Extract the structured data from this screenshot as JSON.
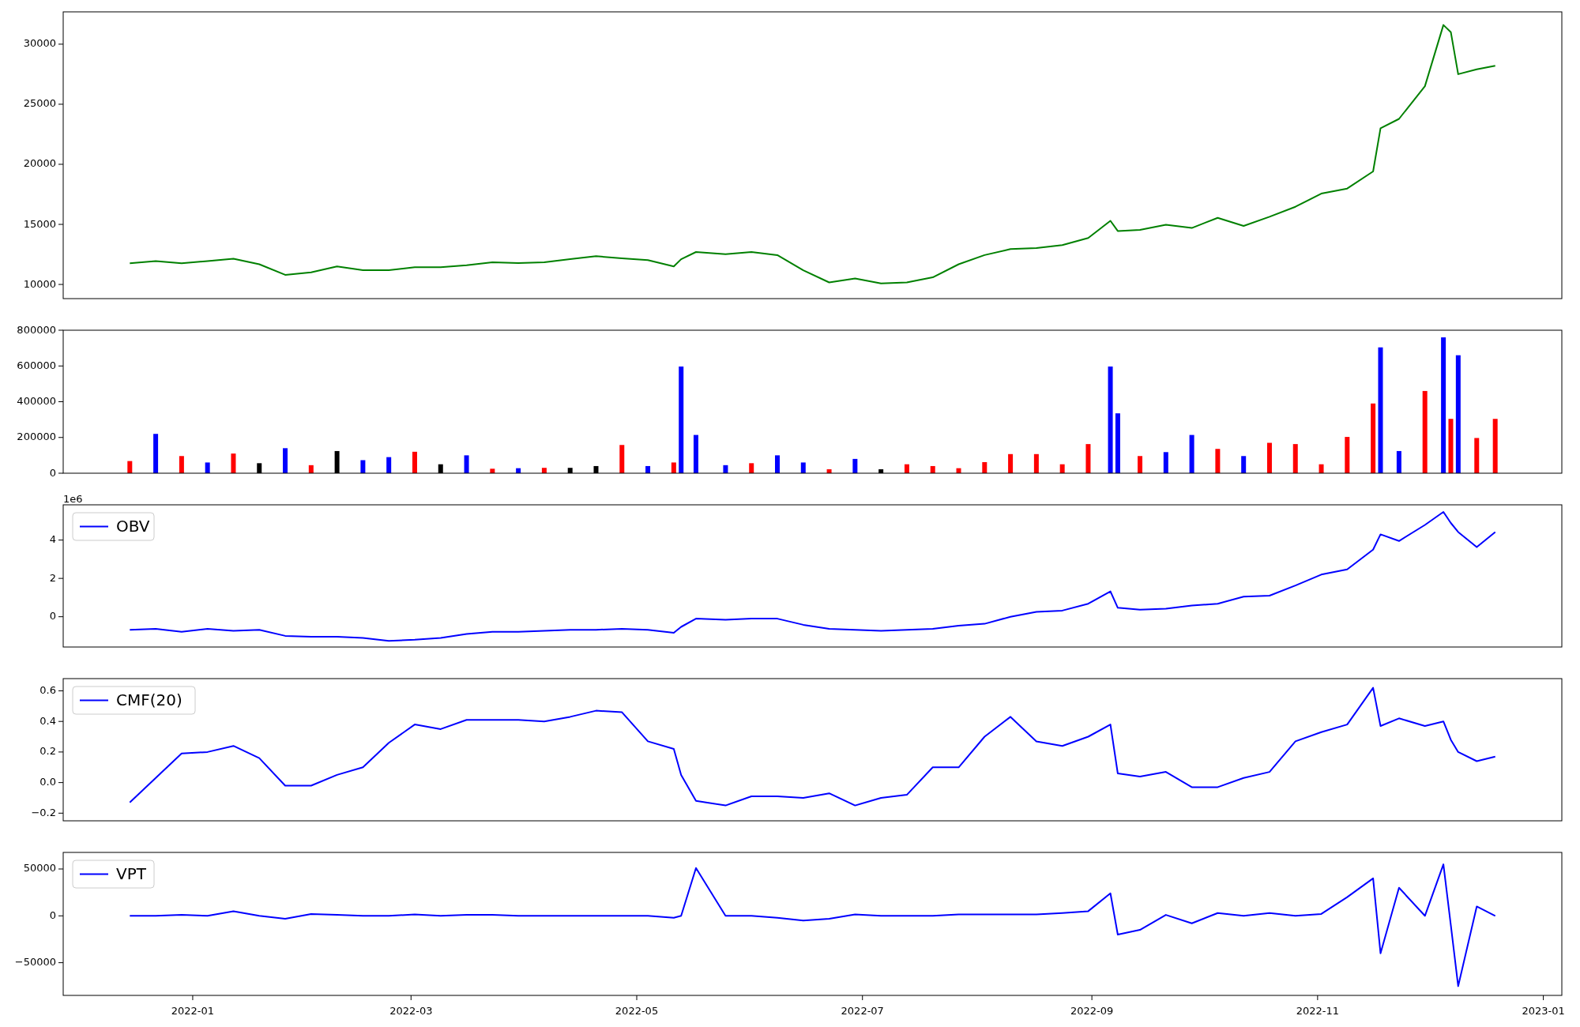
{
  "panels": [
    {
      "chart_data": {
        "type": "line",
        "x": [
          "2021-12-15",
          "2021-12-22",
          "2021-12-29",
          "2022-01-05",
          "2022-01-12",
          "2022-01-19",
          "2022-01-26",
          "2022-02-02",
          "2022-02-09",
          "2022-02-16",
          "2022-02-23",
          "2022-03-02",
          "2022-03-09",
          "2022-03-16",
          "2022-03-23",
          "2022-03-30",
          "2022-04-06",
          "2022-04-13",
          "2022-04-20",
          "2022-04-27",
          "2022-05-04",
          "2022-05-11",
          "2022-05-13",
          "2022-05-17",
          "2022-05-25",
          "2022-06-01",
          "2022-06-08",
          "2022-06-15",
          "2022-06-22",
          "2022-06-29",
          "2022-07-06",
          "2022-07-13",
          "2022-07-20",
          "2022-07-27",
          "2022-08-03",
          "2022-08-10",
          "2022-08-17",
          "2022-08-24",
          "2022-08-31",
          "2022-09-06",
          "2022-09-08",
          "2022-09-14",
          "2022-09-21",
          "2022-09-28",
          "2022-10-05",
          "2022-10-12",
          "2022-10-19",
          "2022-10-26",
          "2022-11-02",
          "2022-11-09",
          "2022-11-16",
          "2022-11-18",
          "2022-11-23",
          "2022-11-30",
          "2022-12-05",
          "2022-12-07",
          "2022-12-09",
          "2022-12-14",
          "2022-12-19"
        ],
        "series": [
          {
            "color": "#008000",
            "values": [
              11760,
              11950,
              11760,
              11950,
              12150,
              11680,
              10800,
              11000,
              11500,
              11180,
              11180,
              11430,
              11430,
              11600,
              11850,
              11770,
              11850,
              12100,
              12350,
              12180,
              12020,
              11500,
              12100,
              12700,
              12520,
              12690,
              12440,
              11180,
              10170,
              10500,
              10080,
              10170,
              10590,
              11680,
              12440,
              12940,
              13030,
              13280,
              13870,
              15300,
              14450,
              14540,
              14960,
              14700,
              15550,
              14870,
              15630,
              16470,
              17560,
              17980,
              19410,
              23000,
              23780,
              26500,
              31600,
              31000,
              27500,
              27900,
              28200
            ]
          }
        ],
        "xlim": [
          "2021-11-27",
          "2023-01-06"
        ],
        "ylim": [
          8820,
          32690
        ],
        "yticks": [
          10000,
          15000,
          20000,
          25000,
          30000
        ]
      }
    },
    {
      "chart_data": {
        "type": "bar",
        "x": [
          "2021-12-15",
          "2021-12-22",
          "2021-12-29",
          "2022-01-05",
          "2022-01-12",
          "2022-01-19",
          "2022-01-26",
          "2022-02-02",
          "2022-02-09",
          "2022-02-16",
          "2022-02-23",
          "2022-03-02",
          "2022-03-09",
          "2022-03-16",
          "2022-03-23",
          "2022-03-30",
          "2022-04-06",
          "2022-04-13",
          "2022-04-20",
          "2022-04-27",
          "2022-05-04",
          "2022-05-11",
          "2022-05-13",
          "2022-05-17",
          "2022-05-25",
          "2022-06-01",
          "2022-06-08",
          "2022-06-15",
          "2022-06-22",
          "2022-06-29",
          "2022-07-06",
          "2022-07-13",
          "2022-07-20",
          "2022-07-27",
          "2022-08-03",
          "2022-08-10",
          "2022-08-17",
          "2022-08-24",
          "2022-08-31",
          "2022-09-06",
          "2022-09-08",
          "2022-09-14",
          "2022-09-21",
          "2022-09-28",
          "2022-10-05",
          "2022-10-12",
          "2022-10-19",
          "2022-10-26",
          "2022-11-02",
          "2022-11-09",
          "2022-11-16",
          "2022-11-18",
          "2022-11-23",
          "2022-11-30",
          "2022-12-05",
          "2022-12-07",
          "2022-12-09",
          "2022-12-14",
          "2022-12-19"
        ],
        "series": [
          {
            "color": "#ff0000",
            "values": [
              68000,
              null,
              96000,
              null,
              110000,
              null,
              null,
              45000,
              null,
              null,
              null,
              120000,
              null,
              null,
              25000,
              null,
              30000,
              null,
              null,
              158000,
              null,
              60000,
              null,
              null,
              null,
              56000,
              null,
              null,
              22000,
              null,
              null,
              50000,
              40000,
              28000,
              62000,
              107000,
              107000,
              50000,
              163000,
              null,
              null,
              96000,
              null,
              null,
              136000,
              null,
              170000,
              163000,
              50000,
              203000,
              390000,
              null,
              null,
              460000,
              null,
              304000,
              null,
              197000,
              304000
            ]
          },
          {
            "color": "#0000ff",
            "values": [
              null,
              220000,
              null,
              60000,
              null,
              null,
              140000,
              null,
              null,
              73000,
              90000,
              null,
              null,
              100000,
              null,
              28000,
              null,
              null,
              null,
              null,
              40000,
              null,
              597000,
              214000,
              45000,
              null,
              100000,
              60000,
              null,
              80000,
              null,
              null,
              null,
              null,
              null,
              null,
              null,
              null,
              null,
              597000,
              335000,
              null,
              118000,
              214000,
              null,
              96000,
              null,
              null,
              null,
              null,
              null,
              704000,
              124000,
              null,
              760000,
              null,
              660000,
              null,
              null
            ]
          },
          {
            "color": "#000000",
            "values": [
              null,
              null,
              null,
              null,
              null,
              56000,
              null,
              null,
              124000,
              null,
              null,
              null,
              50000,
              null,
              null,
              null,
              null,
              30000,
              40000,
              null,
              null,
              null,
              null,
              null,
              null,
              null,
              null,
              null,
              null,
              null,
              22000,
              null,
              null,
              null,
              null,
              null,
              null,
              null,
              null,
              null,
              null,
              null,
              null,
              null,
              null,
              null,
              null,
              null,
              null,
              null,
              null,
              null,
              null,
              null,
              null,
              null,
              null,
              null,
              null
            ]
          }
        ],
        "xlim": [
          "2021-11-27",
          "2023-01-06"
        ],
        "ylim": [
          0,
          800000
        ],
        "yticks": [
          0,
          200000,
          400000,
          600000,
          800000
        ]
      }
    },
    {
      "chart_data": {
        "type": "line",
        "x": [
          "2021-12-15",
          "2021-12-22",
          "2021-12-29",
          "2022-01-05",
          "2022-01-12",
          "2022-01-19",
          "2022-01-26",
          "2022-02-02",
          "2022-02-09",
          "2022-02-16",
          "2022-02-23",
          "2022-03-02",
          "2022-03-09",
          "2022-03-16",
          "2022-03-23",
          "2022-03-30",
          "2022-04-06",
          "2022-04-13",
          "2022-04-20",
          "2022-04-27",
          "2022-05-04",
          "2022-05-11",
          "2022-05-13",
          "2022-05-17",
          "2022-05-25",
          "2022-06-01",
          "2022-06-08",
          "2022-06-15",
          "2022-06-22",
          "2022-06-29",
          "2022-07-06",
          "2022-07-13",
          "2022-07-20",
          "2022-07-27",
          "2022-08-03",
          "2022-08-10",
          "2022-08-17",
          "2022-08-24",
          "2022-08-31",
          "2022-09-06",
          "2022-09-08",
          "2022-09-14",
          "2022-09-21",
          "2022-09-28",
          "2022-10-05",
          "2022-10-12",
          "2022-10-19",
          "2022-10-26",
          "2022-11-02",
          "2022-11-09",
          "2022-11-16",
          "2022-11-18",
          "2022-11-23",
          "2022-11-30",
          "2022-12-05",
          "2022-12-07",
          "2022-12-09",
          "2022-12-14",
          "2022-12-19"
        ],
        "series": [
          {
            "name": "OBV",
            "color": "#0000ff",
            "values": [
              -0.68,
              -0.63,
              -0.79,
              -0.63,
              -0.74,
              -0.68,
              -1.0,
              -1.05,
              -1.05,
              -1.1,
              -1.26,
              -1.2,
              -1.1,
              -0.9,
              -0.79,
              -0.79,
              -0.74,
              -0.68,
              -0.68,
              -0.63,
              -0.68,
              -0.84,
              -0.53,
              -0.1,
              -0.16,
              -0.1,
              -0.1,
              -0.42,
              -0.63,
              -0.68,
              -0.74,
              -0.68,
              -0.63,
              -0.47,
              -0.37,
              0.0,
              0.26,
              0.32,
              0.68,
              1.32,
              0.47,
              0.37,
              0.42,
              0.58,
              0.68,
              1.05,
              1.1,
              1.63,
              2.2,
              2.47,
              3.5,
              4.3,
              3.95,
              4.79,
              5.47,
              4.89,
              4.42,
              3.63,
              4.42
            ]
          }
        ],
        "xlim": [
          "2021-11-27",
          "2023-01-06"
        ],
        "ylim": [
          -1.58,
          5.84
        ],
        "yticks": [
          0,
          2,
          4
        ],
        "annotations": [
          {
            "text": "1e6"
          }
        ]
      }
    },
    {
      "chart_data": {
        "type": "line",
        "x": [
          "2021-12-15",
          "2021-12-22",
          "2021-12-29",
          "2022-01-05",
          "2022-01-12",
          "2022-01-19",
          "2022-01-26",
          "2022-02-02",
          "2022-02-09",
          "2022-02-16",
          "2022-02-23",
          "2022-03-02",
          "2022-03-09",
          "2022-03-16",
          "2022-03-23",
          "2022-03-30",
          "2022-04-06",
          "2022-04-13",
          "2022-04-20",
          "2022-04-27",
          "2022-05-04",
          "2022-05-11",
          "2022-05-13",
          "2022-05-17",
          "2022-05-25",
          "2022-06-01",
          "2022-06-08",
          "2022-06-15",
          "2022-06-22",
          "2022-06-29",
          "2022-07-06",
          "2022-07-13",
          "2022-07-20",
          "2022-07-27",
          "2022-08-03",
          "2022-08-10",
          "2022-08-17",
          "2022-08-24",
          "2022-08-31",
          "2022-09-06",
          "2022-09-08",
          "2022-09-14",
          "2022-09-21",
          "2022-09-28",
          "2022-10-05",
          "2022-10-12",
          "2022-10-19",
          "2022-10-26",
          "2022-11-02",
          "2022-11-09",
          "2022-11-16",
          "2022-11-18",
          "2022-11-23",
          "2022-11-30",
          "2022-12-05",
          "2022-12-07",
          "2022-12-09",
          "2022-12-14",
          "2022-12-19"
        ],
        "series": [
          {
            "name": "CMF(20)",
            "color": "#0000ff",
            "values": [
              -0.13,
              0.03,
              0.19,
              0.2,
              0.24,
              0.16,
              -0.02,
              -0.02,
              0.05,
              0.1,
              0.26,
              0.38,
              0.35,
              0.41,
              0.41,
              0.41,
              0.4,
              0.43,
              0.47,
              0.46,
              0.27,
              0.22,
              0.05,
              -0.12,
              -0.15,
              -0.09,
              -0.09,
              -0.1,
              -0.07,
              -0.15,
              -0.1,
              -0.08,
              0.1,
              0.1,
              0.3,
              0.43,
              0.27,
              0.24,
              0.3,
              0.38,
              0.06,
              0.04,
              0.07,
              -0.03,
              -0.03,
              0.03,
              0.07,
              0.27,
              0.33,
              0.38,
              0.62,
              0.37,
              0.42,
              0.37,
              0.4,
              0.28,
              0.2,
              0.14,
              0.17
            ]
          }
        ],
        "xlim": [
          "2021-11-27",
          "2023-01-06"
        ],
        "ylim": [
          -0.25,
          0.68
        ],
        "yticks": [
          {
            "value": -0.2,
            "label": "−0.2"
          },
          {
            "value": 0,
            "label": "0.0"
          },
          {
            "value": 0.2,
            "label": "0.2"
          },
          {
            "value": 0.4,
            "label": "0.4"
          },
          {
            "value": 0.6,
            "label": "0.6"
          }
        ]
      }
    },
    {
      "chart_data": {
        "type": "line",
        "x": [
          "2021-12-15",
          "2021-12-22",
          "2021-12-29",
          "2022-01-05",
          "2022-01-12",
          "2022-01-19",
          "2022-01-26",
          "2022-02-02",
          "2022-02-09",
          "2022-02-16",
          "2022-02-23",
          "2022-03-02",
          "2022-03-09",
          "2022-03-16",
          "2022-03-23",
          "2022-03-30",
          "2022-04-06",
          "2022-04-13",
          "2022-04-20",
          "2022-04-27",
          "2022-05-04",
          "2022-05-11",
          "2022-05-13",
          "2022-05-17",
          "2022-05-25",
          "2022-06-01",
          "2022-06-08",
          "2022-06-15",
          "2022-06-22",
          "2022-06-29",
          "2022-07-06",
          "2022-07-13",
          "2022-07-20",
          "2022-07-27",
          "2022-08-03",
          "2022-08-10",
          "2022-08-17",
          "2022-08-24",
          "2022-08-31",
          "2022-09-06",
          "2022-09-08",
          "2022-09-14",
          "2022-09-21",
          "2022-09-28",
          "2022-10-05",
          "2022-10-12",
          "2022-10-19",
          "2022-10-26",
          "2022-11-02",
          "2022-11-09",
          "2022-11-16",
          "2022-11-18",
          "2022-11-23",
          "2022-11-30",
          "2022-12-05",
          "2022-12-07",
          "2022-12-09",
          "2022-12-14",
          "2022-12-19"
        ],
        "series": [
          {
            "name": "VPT",
            "color": "#0000ff",
            "values": [
              0,
              0,
              1000,
              0,
              5000,
              0,
              -3000,
              2000,
              1000,
              0,
              0,
              1500,
              0,
              1000,
              1000,
              0,
              0,
              0,
              0,
              0,
              0,
              -2000,
              0,
              51000,
              0,
              0,
              -2000,
              -5000,
              -3000,
              1500,
              0,
              0,
              0,
              1500,
              1500,
              1500,
              1500,
              3000,
              5000,
              24000,
              -20000,
              -15000,
              1000,
              -8000,
              3000,
              0,
              3000,
              0,
              2000,
              20000,
              40000,
              -40000,
              30000,
              0,
              55000,
              -10000,
              -75000,
              10000,
              0
            ]
          }
        ],
        "xlim": [
          "2021-11-27",
          "2023-01-06"
        ],
        "ylim": [
          -84900,
          67700
        ],
        "yticks": [
          {
            "value": -50000,
            "label": "−50000"
          },
          {
            "value": 0,
            "label": "0"
          },
          {
            "value": 50000,
            "label": "50000"
          }
        ],
        "xticks": [
          {
            "value": "2022-01-01",
            "label": "2022-01"
          },
          {
            "value": "2022-03-01",
            "label": "2022-03"
          },
          {
            "value": "2022-05-01",
            "label": "2022-05"
          },
          {
            "value": "2022-07-01",
            "label": "2022-07"
          },
          {
            "value": "2022-09-01",
            "label": "2022-09"
          },
          {
            "value": "2022-11-01",
            "label": "2022-11"
          },
          {
            "value": "2023-01-01",
            "label": "2023-01"
          }
        ]
      }
    }
  ]
}
